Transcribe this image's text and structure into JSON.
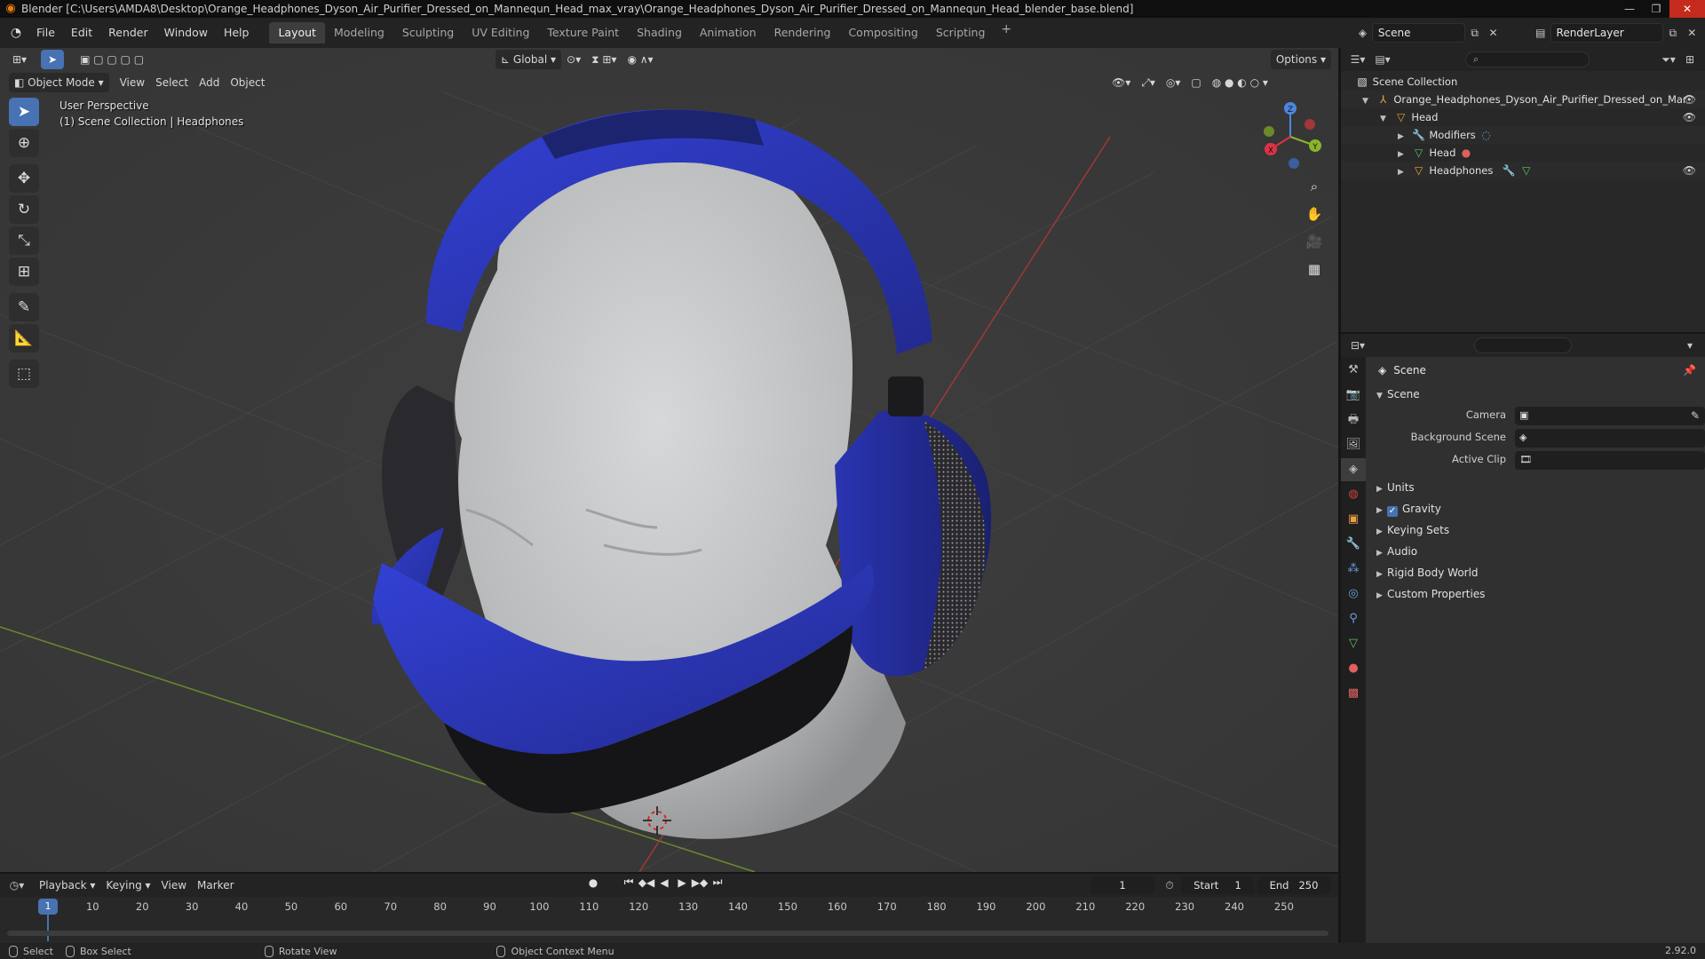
{
  "window": {
    "title": "Blender [C:\\Users\\AMDA8\\Desktop\\Orange_Headphones_Dyson_Air_Purifier_Dressed_on_Mannequn_Head_max_vray\\Orange_Headphones_Dyson_Air_Purifier_Dressed_on_Mannequn_Head_blender_base.blend]"
  },
  "menu": {
    "file": "File",
    "edit": "Edit",
    "render": "Render",
    "window": "Window",
    "help": "Help"
  },
  "workspaces": {
    "tabs": [
      "Layout",
      "Modeling",
      "Sculpting",
      "UV Editing",
      "Texture Paint",
      "Shading",
      "Animation",
      "Rendering",
      "Compositing",
      "Scripting"
    ],
    "active": "Layout",
    "plus": "+"
  },
  "scene_selector": {
    "value": "Scene"
  },
  "viewlayer_selector": {
    "value": "RenderLayer"
  },
  "viewport": {
    "transform_orientation": "Global",
    "options_label": "Options",
    "mode": "Object Mode",
    "menus": [
      "View",
      "Select",
      "Add",
      "Object"
    ],
    "info_line1": "User Perspective",
    "info_line2": "(1) Scene Collection | Headphones",
    "gizmo": {
      "x": "X",
      "y": "Y",
      "z": "Z"
    }
  },
  "outliner": {
    "rows": [
      {
        "label": "Scene Collection"
      },
      {
        "label": "Orange_Headphones_Dyson_Air_Purifier_Dressed_on_Mannequn_Head_max_vray"
      },
      {
        "label": "Head"
      },
      {
        "label": "Modifiers"
      },
      {
        "label": "Head"
      },
      {
        "label": "Headphones"
      }
    ]
  },
  "properties": {
    "title": "Scene",
    "panel_scene": "Scene",
    "camera_label": "Camera",
    "background_scene_label": "Background Scene",
    "active_clip_label": "Active Clip",
    "panels": [
      "Units",
      "Gravity",
      "Keying Sets",
      "Audio",
      "Rigid Body World",
      "Custom Properties"
    ]
  },
  "timeline": {
    "menus": [
      "Playback",
      "Keying",
      "View",
      "Marker"
    ],
    "current_frame": "1",
    "start_label": "Start",
    "start_value": "1",
    "end_label": "End",
    "end_value": "250",
    "ticks": [
      "1",
      "10",
      "20",
      "30",
      "40",
      "50",
      "60",
      "70",
      "80",
      "90",
      "100",
      "110",
      "120",
      "130",
      "140",
      "150",
      "160",
      "170",
      "180",
      "190",
      "200",
      "210",
      "220",
      "230",
      "240",
      "250"
    ]
  },
  "statusbar": {
    "select": "Select",
    "box_select": "Box Select",
    "rotate_view": "Rotate View",
    "context_menu": "Object Context Menu",
    "version": "2.92.0"
  },
  "colors": {
    "accent": "#4772b3",
    "headphones": "#2b35b8",
    "mannequin": "#c9cbcc"
  }
}
